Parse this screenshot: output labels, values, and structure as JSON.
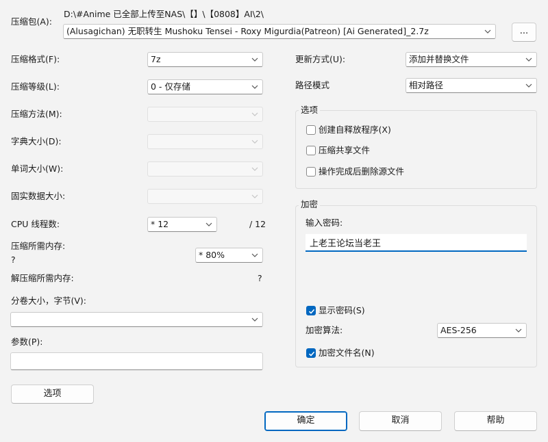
{
  "archive": {
    "label": "压缩包(A):",
    "path": "D:\\#Anime 已全部上传至NAS\\【】\\【0808】AI\\2\\",
    "filename": "(Alusagichan) 无职转生 Mushoku Tensei - Roxy Migurdia(Patreon) [Ai Generated]_2.7z",
    "browse_label": "..."
  },
  "left": {
    "format_label": "压缩格式(F):",
    "format_value": "7z",
    "level_label": "压缩等级(L):",
    "level_value": "0 - 仅存储",
    "method_label": "压缩方法(M):",
    "dict_label": "字典大小(D):",
    "word_label": "单词大小(W):",
    "solid_label": "固实数据大小:",
    "threads_label": "CPU 线程数:",
    "threads_value": "* 12",
    "threads_total": "/ 12",
    "mem_label": "压缩所需内存:",
    "mem_value_text": "?",
    "mem_value": "* 80%",
    "decomp_label": "解压缩所需内存:",
    "decomp_value": "?",
    "volume_label": "分卷大小，字节(V):",
    "volume_value": "",
    "params_label": "参数(P):",
    "params_value": "",
    "options_button": "选项"
  },
  "right": {
    "update_label": "更新方式(U):",
    "update_value": "添加并替换文件",
    "pathmode_label": "路径模式",
    "pathmode_value": "相对路径",
    "options_group": "选项",
    "opt_sfx": "创建自释放程序(X)",
    "opt_shared": "压缩共享文件",
    "opt_delete": "操作完成后删除源文件",
    "encrypt_group": "加密",
    "password_label": "输入密码:",
    "password_value": "上老王论坛当老王",
    "show_password": "显示密码(S)",
    "algo_label": "加密算法:",
    "algo_value": "AES-256",
    "encrypt_names": "加密文件名(N)"
  },
  "buttons": {
    "ok": "确定",
    "cancel": "取消",
    "help": "帮助"
  },
  "colors": {
    "accent": "#0067c0",
    "background": "#f3f3f3"
  }
}
